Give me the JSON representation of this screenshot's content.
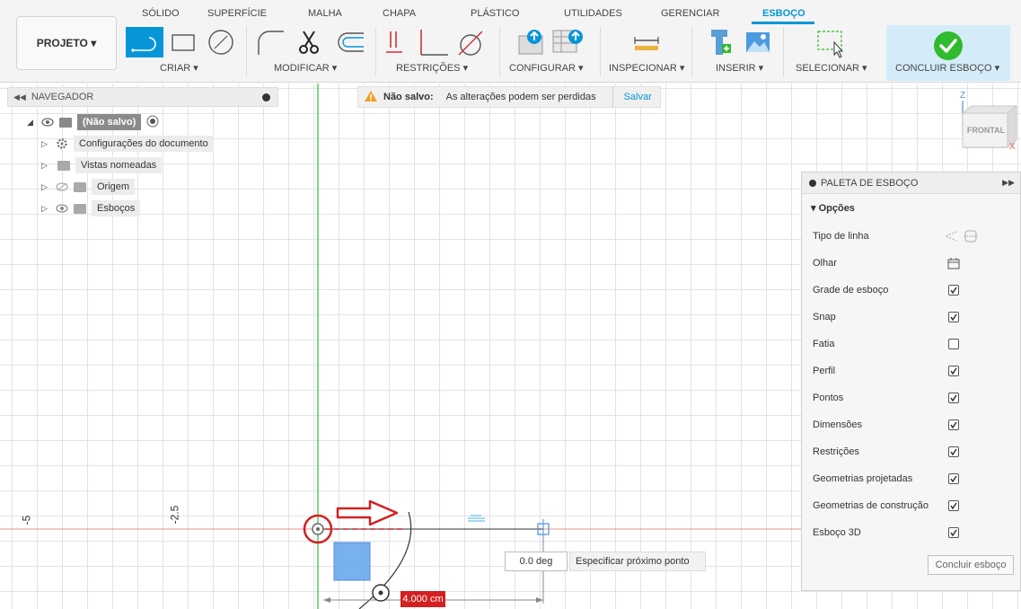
{
  "tabs": [
    "SÓLIDO",
    "SUPERFÍCIE",
    "MALHA",
    "CHAPA",
    "PLÁSTICO",
    "UTILIDADES",
    "GERENCIAR",
    "ESBOÇO"
  ],
  "active_tab": "ESBOÇO",
  "workspace_button": "PROJETO ▾",
  "groups": {
    "criar": "CRIAR ▾",
    "modificar": "MODIFICAR ▾",
    "restricoes": "RESTRIÇÕES ▾",
    "configurar": "CONFIGURAR ▾",
    "inspecionar": "INSPECIONAR ▾",
    "inserir": "INSERIR ▾",
    "selecionar": "SELECIONAR ▾",
    "concluir": "CONCLUIR ESBOÇO ▾"
  },
  "navigator": {
    "title": "NAVEGADOR",
    "root": "(Não salvo)",
    "items": [
      "Configurações do documento",
      "Vistas nomeadas",
      "Origem",
      "Esboços"
    ]
  },
  "savebar": {
    "status": "Não salvo:",
    "message": "As alterações podem ser perdidas",
    "action": "Salvar"
  },
  "viewcube": {
    "face": "FRONTAL",
    "axis_z": "Z",
    "axis_x": "X"
  },
  "palette": {
    "title": "PALETA DE ESBOÇO",
    "section": "▾ Opções",
    "options": [
      {
        "label": "Tipo de linha"
      },
      {
        "label": "Olhar"
      },
      {
        "label": "Grade de esboço",
        "checked": true
      },
      {
        "label": "Snap",
        "checked": true
      },
      {
        "label": "Fatia",
        "checked": false
      },
      {
        "label": "Perfil",
        "checked": true
      },
      {
        "label": "Pontos",
        "checked": true
      },
      {
        "label": "Dimensões",
        "checked": true
      },
      {
        "label": "Restrições",
        "checked": true
      },
      {
        "label": "Geometrias projetadas",
        "checked": true
      },
      {
        "label": "Geometrias de construção",
        "checked": true
      },
      {
        "label": "Esboço 3D",
        "checked": true
      }
    ],
    "finish_button": "Concluir esboço"
  },
  "canvas": {
    "axis_labels": [
      "-5",
      "-2.5"
    ],
    "angle_value": "0.0 deg",
    "prompt": "Especificar próximo ponto",
    "dimension_value": "4.000 cm"
  },
  "colors": {
    "accent": "#0696d7",
    "x_axis": "#e05a5a",
    "y_axis": "#2fbf2f",
    "concluir_bg": "#d4ecf7",
    "check_green": "#2ebb2e",
    "highlight_red": "#d42020"
  }
}
